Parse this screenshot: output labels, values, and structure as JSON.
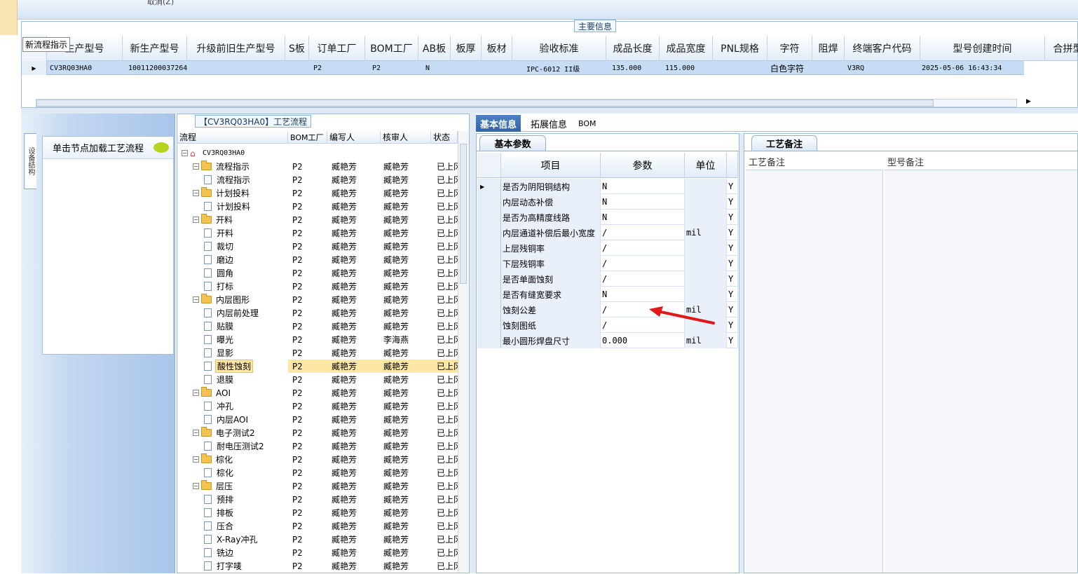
{
  "toolbar": {
    "cancel_label": "取消(Z)"
  },
  "main_info": {
    "section_label": "主要信息",
    "tooltip": "新流程指示",
    "columns": [
      "生产型号",
      "新生产型号",
      "升级前旧生产型号",
      "S板",
      "订单工厂",
      "BOM工厂",
      "AB板",
      "板厚",
      "板材",
      "验收标准",
      "成品长度",
      "成品宽度",
      "PNL规格",
      "字符",
      "阻焊",
      "终端客户代码",
      "型号创建时间",
      "合拼型号"
    ],
    "row": {
      "c0": "CV3RQ03HA0",
      "c1": "10011200037264",
      "c4": "P2",
      "c5": "P2",
      "c6": "N",
      "c9": "IPC-6012 II级",
      "c10": "135.000",
      "c11": "115.000",
      "c13": "白色字符",
      "c15": "V3RQ",
      "c16": "2025-05-06 16:43:34"
    }
  },
  "left_panel": {
    "vertical_tab": "设备结构",
    "load_hint": "单击节点加载工艺流程"
  },
  "tree": {
    "title": "【CV3RQ03HA0】工艺流程",
    "headers": [
      "流程",
      "BOM工厂",
      "编写人",
      "核审人",
      "状态"
    ],
    "root": "CV3RQ03HA0",
    "rows": [
      {
        "name": "流程指示",
        "lvl": 1,
        "folder": true,
        "f": "P2",
        "w": "臧艳芳",
        "r": "臧艳芳",
        "s": "已上冈"
      },
      {
        "name": "流程指示",
        "lvl": 2,
        "folder": false,
        "f": "P2",
        "w": "臧艳芳",
        "r": "臧艳芳",
        "s": "已上冈"
      },
      {
        "name": "计划投料",
        "lvl": 1,
        "folder": true,
        "f": "P2",
        "w": "臧艳芳",
        "r": "臧艳芳",
        "s": "已上冈"
      },
      {
        "name": "计划投料",
        "lvl": 2,
        "folder": false,
        "f": "P2",
        "w": "臧艳芳",
        "r": "臧艳芳",
        "s": "已上冈"
      },
      {
        "name": "开料",
        "lvl": 1,
        "folder": true,
        "f": "P2",
        "w": "臧艳芳",
        "r": "臧艳芳",
        "s": "已上冈"
      },
      {
        "name": "开料",
        "lvl": 2,
        "folder": false,
        "f": "P2",
        "w": "臧艳芳",
        "r": "臧艳芳",
        "s": "已上冈"
      },
      {
        "name": "裁切",
        "lvl": 2,
        "folder": false,
        "f": "P2",
        "w": "臧艳芳",
        "r": "臧艳芳",
        "s": "已上冈"
      },
      {
        "name": "磨边",
        "lvl": 2,
        "folder": false,
        "f": "P2",
        "w": "臧艳芳",
        "r": "臧艳芳",
        "s": "已上冈"
      },
      {
        "name": "圆角",
        "lvl": 2,
        "folder": false,
        "f": "P2",
        "w": "臧艳芳",
        "r": "臧艳芳",
        "s": "已上冈"
      },
      {
        "name": "打标",
        "lvl": 2,
        "folder": false,
        "f": "P2",
        "w": "臧艳芳",
        "r": "臧艳芳",
        "s": "已上冈"
      },
      {
        "name": "内层图形",
        "lvl": 1,
        "folder": true,
        "f": "P2",
        "w": "臧艳芳",
        "r": "臧艳芳",
        "s": "已上冈"
      },
      {
        "name": "内层前处理",
        "lvl": 2,
        "folder": false,
        "f": "P2",
        "w": "臧艳芳",
        "r": "臧艳芳",
        "s": "已上冈"
      },
      {
        "name": "贴膜",
        "lvl": 2,
        "folder": false,
        "f": "P2",
        "w": "臧艳芳",
        "r": "臧艳芳",
        "s": "已上冈"
      },
      {
        "name": "曝光",
        "lvl": 2,
        "folder": false,
        "f": "P2",
        "w": "臧艳芳",
        "r": "李海燕",
        "s": "已上冈"
      },
      {
        "name": "显影",
        "lvl": 2,
        "folder": false,
        "f": "P2",
        "w": "臧艳芳",
        "r": "臧艳芳",
        "s": "已上冈"
      },
      {
        "name": "酸性蚀刻",
        "lvl": 2,
        "folder": false,
        "f": "P2",
        "w": "臧艳芳",
        "r": "臧艳芳",
        "s": "已上冈",
        "sel": true
      },
      {
        "name": "退膜",
        "lvl": 2,
        "folder": false,
        "f": "P2",
        "w": "臧艳芳",
        "r": "臧艳芳",
        "s": "已上冈"
      },
      {
        "name": "AOI",
        "lvl": 1,
        "folder": true,
        "f": "P2",
        "w": "臧艳芳",
        "r": "臧艳芳",
        "s": "已上冈"
      },
      {
        "name": "冲孔",
        "lvl": 2,
        "folder": false,
        "f": "P2",
        "w": "臧艳芳",
        "r": "臧艳芳",
        "s": "已上冈"
      },
      {
        "name": "内层AOI",
        "lvl": 2,
        "folder": false,
        "f": "P2",
        "w": "臧艳芳",
        "r": "臧艳芳",
        "s": "已上冈"
      },
      {
        "name": "电子测试2",
        "lvl": 1,
        "folder": true,
        "f": "P2",
        "w": "臧艳芳",
        "r": "臧艳芳",
        "s": "已上冈"
      },
      {
        "name": "耐电压测试2",
        "lvl": 2,
        "folder": false,
        "f": "P2",
        "w": "臧艳芳",
        "r": "臧艳芳",
        "s": "已上冈"
      },
      {
        "name": "棕化",
        "lvl": 1,
        "folder": true,
        "f": "P2",
        "w": "臧艳芳",
        "r": "臧艳芳",
        "s": "已上冈"
      },
      {
        "name": "棕化",
        "lvl": 2,
        "folder": false,
        "f": "P2",
        "w": "臧艳芳",
        "r": "臧艳芳",
        "s": "已上冈"
      },
      {
        "name": "层压",
        "lvl": 1,
        "folder": true,
        "f": "P2",
        "w": "臧艳芳",
        "r": "臧艳芳",
        "s": "已上冈"
      },
      {
        "name": "预排",
        "lvl": 2,
        "folder": false,
        "f": "P2",
        "w": "臧艳芳",
        "r": "臧艳芳",
        "s": "已上冈"
      },
      {
        "name": "排板",
        "lvl": 2,
        "folder": false,
        "f": "P2",
        "w": "臧艳芳",
        "r": "臧艳芳",
        "s": "已上冈"
      },
      {
        "name": "压合",
        "lvl": 2,
        "folder": false,
        "f": "P2",
        "w": "臧艳芳",
        "r": "臧艳芳",
        "s": "已上冈"
      },
      {
        "name": "X-Ray冲孔",
        "lvl": 2,
        "folder": false,
        "f": "P2",
        "w": "臧艳芳",
        "r": "臧艳芳",
        "s": "已上冈"
      },
      {
        "name": "铣边",
        "lvl": 2,
        "folder": false,
        "f": "P2",
        "w": "臧艳芳",
        "r": "臧艳芳",
        "s": "已上冈"
      },
      {
        "name": "打字唛",
        "lvl": 2,
        "folder": false,
        "f": "P2",
        "w": "臧艳芳",
        "r": "臧艳芳",
        "s": "已上冈"
      }
    ]
  },
  "right_tabs": [
    "基本信息",
    "拓展信息",
    "BOM"
  ],
  "params": {
    "tab": "基本参数",
    "headers": [
      "项目",
      "参数",
      "单位"
    ],
    "rows": [
      {
        "item": "是否为阴阳铜结构",
        "val": "N",
        "unit": "",
        "flag": "Y"
      },
      {
        "item": "内层动态补偿",
        "val": "N",
        "unit": "",
        "flag": "Y"
      },
      {
        "item": "是否为高精度线路",
        "val": "N",
        "unit": "",
        "flag": "Y"
      },
      {
        "item": "内层通道补偿后最小宽度",
        "val": "/",
        "unit": "mil",
        "flag": "Y"
      },
      {
        "item": "上层残铜率",
        "val": "/",
        "unit": "",
        "flag": "Y"
      },
      {
        "item": "下层残铜率",
        "val": "/",
        "unit": "",
        "flag": "Y"
      },
      {
        "item": "是否单面蚀刻",
        "val": "/",
        "unit": "",
        "flag": "Y"
      },
      {
        "item": "是否有缝宽要求",
        "val": "N",
        "unit": "",
        "flag": "Y"
      },
      {
        "item": "蚀刻公差",
        "val": "/",
        "unit": "mil",
        "flag": "Y"
      },
      {
        "item": "蚀刻图纸",
        "val": "/",
        "unit": "",
        "flag": "Y"
      },
      {
        "item": "最小圆形焊盘尺寸",
        "val": "0.000",
        "unit": "mil",
        "flag": "Y"
      }
    ]
  },
  "notes": {
    "tab": "工艺备注",
    "col1": "工艺备注",
    "col2": "型号备注"
  },
  "colors": {
    "accent": "#2f62a6",
    "selected_row": "#c6dcf4",
    "tree_selected": "#fce7a5",
    "arrow": "#e01818"
  }
}
